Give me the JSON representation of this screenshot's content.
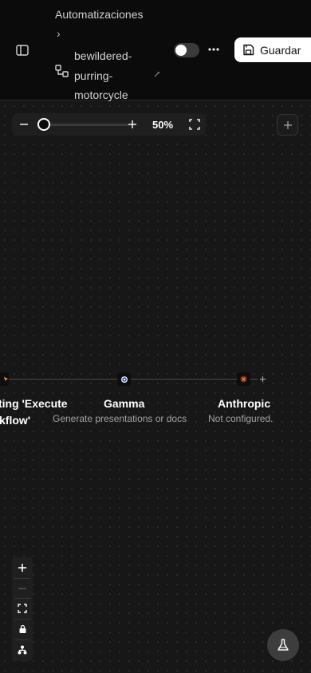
{
  "header": {
    "breadcrumb_root": "Automatizaciones",
    "breadcrumb_separator": "›",
    "workflow_name": "bewildered-purring-motorcycle",
    "active_toggle": false,
    "save_label": "Guardar"
  },
  "zoom": {
    "label": "50%",
    "value_percent": 50
  },
  "nodes": [
    {
      "title": "ting 'Execute",
      "title_line2": "kflow'",
      "subtitle": "",
      "icon": "pointer-icon",
      "color": "#f59e0b"
    },
    {
      "title": "Gamma",
      "subtitle": "Generate presentations or docs",
      "icon": "gamma-icon",
      "color": "#93c5fd"
    },
    {
      "title": "Anthropic",
      "subtitle": "Not configured.",
      "icon": "anthropic-icon",
      "color": "#ea580c"
    }
  ],
  "colors": {
    "canvas_bg": "#171717",
    "header_bg": "#0b0b0b",
    "save_bg": "#ffffff"
  }
}
